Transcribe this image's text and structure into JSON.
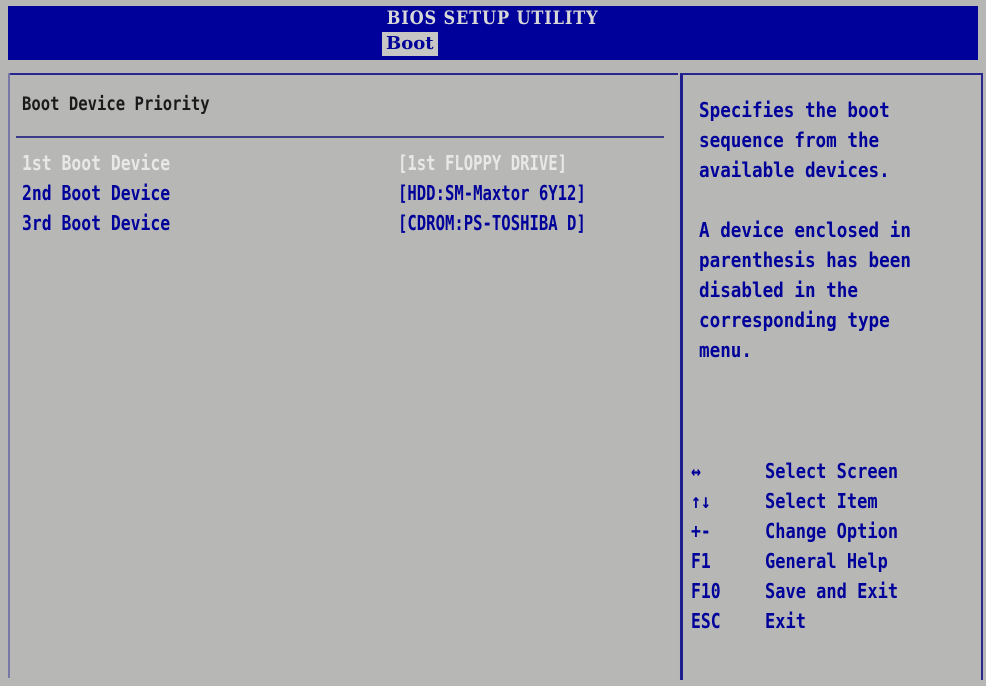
{
  "header": {
    "title": "BIOS SETUP UTILITY",
    "active_tab": "Boot"
  },
  "main": {
    "section_title": "Boot Device Priority",
    "rows": [
      {
        "label": "1st Boot Device",
        "value": "[1st FLOPPY DRIVE]",
        "selected": true
      },
      {
        "label": "2nd Boot Device",
        "value": "[HDD:SM-Maxtor 6Y12]",
        "selected": false
      },
      {
        "label": "3rd Boot Device",
        "value": "[CDROM:PS-TOSHIBA D]",
        "selected": false
      }
    ]
  },
  "help": {
    "description": "Specifies the boot\nsequence from the\navailable devices.",
    "note": "A device enclosed in\nparenthesis has been\ndisabled in the\ncorresponding type\nmenu.",
    "keys": [
      {
        "key": "↔",
        "desc": "Select Screen"
      },
      {
        "key": "↑↓",
        "desc": "Select Item"
      },
      {
        "key": "+-",
        "desc": "Change Option"
      },
      {
        "key": "F1",
        "desc": "General Help"
      },
      {
        "key": "F10",
        "desc": "Save and Exit"
      },
      {
        "key": "ESC",
        "desc": "Exit"
      }
    ]
  },
  "colors": {
    "bar_blue": "#00009a",
    "panel_gray": "#b7b7b5",
    "text_blue": "#00009a",
    "selected_text": "#e8e8e8"
  }
}
